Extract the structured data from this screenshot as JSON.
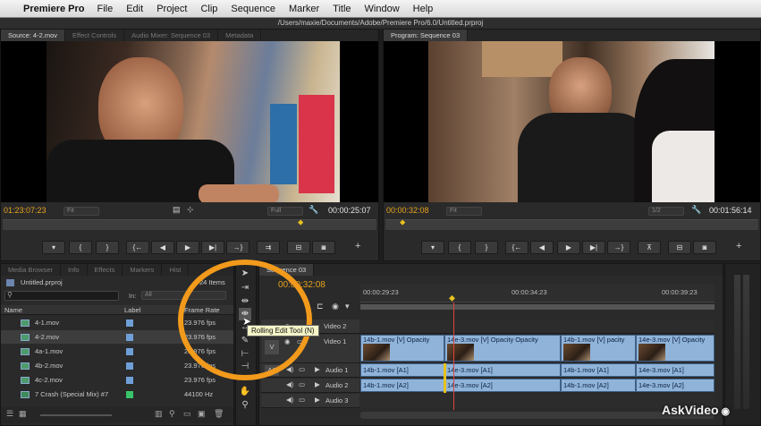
{
  "menubar": {
    "app_name": "Premiere Pro",
    "items": [
      "File",
      "Edit",
      "Project",
      "Clip",
      "Sequence",
      "Marker",
      "Title",
      "Window",
      "Help"
    ]
  },
  "window_title": "/Users/maxie/Documents/Adobe/Premiere Pro/6.0/Untitled.prproj",
  "source_monitor": {
    "tabs": [
      "Source: 4-2.mov",
      "Effect Controls",
      "Audio Mixer: Sequence 03",
      "Metadata"
    ],
    "timecode_in": "01:23:07:23",
    "fit": "Fit",
    "quality": "Full",
    "duration": "00:00:25:07"
  },
  "program_monitor": {
    "tabs": [
      "Program: Sequence 03"
    ],
    "timecode": "00:00:32:08",
    "fit": "Fit",
    "quality": "1/2",
    "duration": "00:01:56:14"
  },
  "project_panel": {
    "tabs": [
      "Media Browser",
      "Info",
      "Effects",
      "Markers",
      "Hist"
    ],
    "project_name": "Untitled.prproj",
    "item_count": "24 Items",
    "in_label": "In:",
    "in_value": "All",
    "columns": {
      "name": "Name",
      "label": "Label",
      "frame_rate": "Frame Rate"
    },
    "rows": [
      {
        "name": "4-1.mov",
        "rate": "23.976 fps",
        "color": "#6f9fd8"
      },
      {
        "name": "4-2.mov",
        "rate": "23.976 fps",
        "color": "#6f9fd8"
      },
      {
        "name": "4a-1.mov",
        "rate": "23.976 fps",
        "color": "#6f9fd8"
      },
      {
        "name": "4b-2.mov",
        "rate": "23.976 fps",
        "color": "#6f9fd8"
      },
      {
        "name": "4c-2.mov",
        "rate": "23.976 fps",
        "color": "#6f9fd8"
      },
      {
        "name": "7 Crash (Special Mix) #7",
        "rate": "44100 Hz",
        "color": "#39c46a"
      }
    ]
  },
  "tooltip": "Rolling Edit Tool (N)",
  "timeline": {
    "tab": "Sequence 03",
    "timecode": "00:00:32:08",
    "ruler": [
      "00:00:29:23",
      "00:00:34:23",
      "00:00:39:23"
    ],
    "tracks": {
      "video2": "Video 2",
      "video1": "Video 1",
      "audio1": "Audio 1",
      "audio2": "Audio 2",
      "audio3": "Audio 3",
      "v_target": "V",
      "a_target": "A1"
    },
    "video_clips": [
      "14b-1.mov [V] Opacity",
      "14e-3.mov [V] Opacity Opacity",
      "14b-1.mov [V] pacity",
      "14e-3.mov [V] Opacity"
    ],
    "audio1_clips": [
      "14b-1.mov [A1]",
      "14e-3.mov [A1]",
      "14b-1.mov [A1]",
      "14e-3.mov [A1]"
    ],
    "audio2_clips": [
      "14b-1.mov [A2]",
      "14e-3.mov [A2]",
      "14b-1.mov [A2]",
      "14e-3.mov [A2]"
    ]
  },
  "watermark": "AskVideo",
  "colors": {
    "accent_orange": "#f29a1c",
    "timecode_orange": "#e6a21e",
    "clip_blue": "#8fb3d9"
  }
}
